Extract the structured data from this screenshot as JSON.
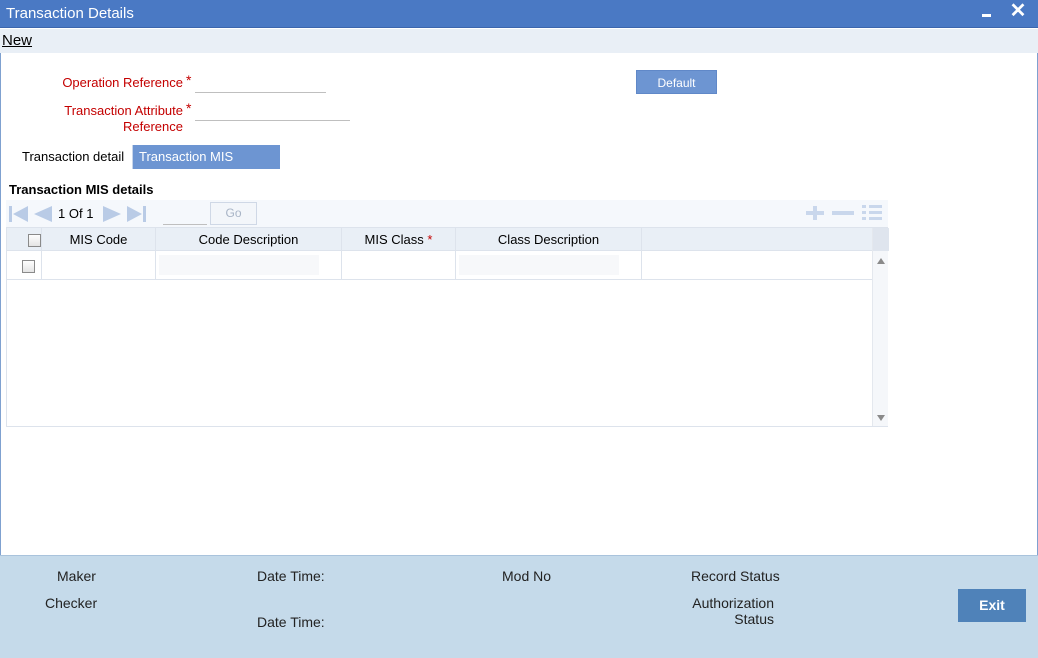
{
  "window": {
    "title": "Transaction Details"
  },
  "menu": {
    "new_label": "New"
  },
  "form": {
    "operation_reference_label": "Operation Reference",
    "operation_reference_value": "",
    "transaction_attribute_label_line1": "Transaction Attribute",
    "transaction_attribute_label_line2": "Reference",
    "transaction_attribute_value": "",
    "required_mark": "*",
    "default_button": "Default"
  },
  "tabs": [
    {
      "label": "Transaction detail",
      "active": false
    },
    {
      "label": "Transaction MIS details",
      "active": true
    }
  ],
  "section": {
    "title": "Transaction MIS details"
  },
  "pager": {
    "current": "1",
    "of_label": "Of",
    "total": "1",
    "go_label": "Go"
  },
  "grid": {
    "columns": [
      "MIS Code",
      "Code Description",
      "MIS Class",
      "Class Description"
    ],
    "required_mark": "*",
    "rows": [
      {
        "mis_code": "",
        "code_description": "",
        "mis_class": "",
        "class_description": ""
      }
    ]
  },
  "footer": {
    "maker_label": "Maker",
    "checker_label": "Checker",
    "date_time_label_1": "Date Time:",
    "date_time_label_2": "Date Time:",
    "mod_no_label": "Mod No",
    "record_status_label": "Record Status",
    "authorization_label_line1": "Authorization",
    "authorization_label_line2": "Status",
    "exit_button": "Exit"
  },
  "colors": {
    "titlebar": "#4a79c4",
    "tab_active": "#6d95d2",
    "required": "#c40000",
    "footer": "#c5daea",
    "exit_button": "#4f82b9"
  },
  "icons": [
    "minimize-icon",
    "close-icon",
    "first-page-icon",
    "prev-page-icon",
    "next-page-icon",
    "last-page-icon",
    "add-row-icon",
    "delete-row-icon",
    "column-settings-icon",
    "scroll-up-icon",
    "scroll-down-icon"
  ]
}
